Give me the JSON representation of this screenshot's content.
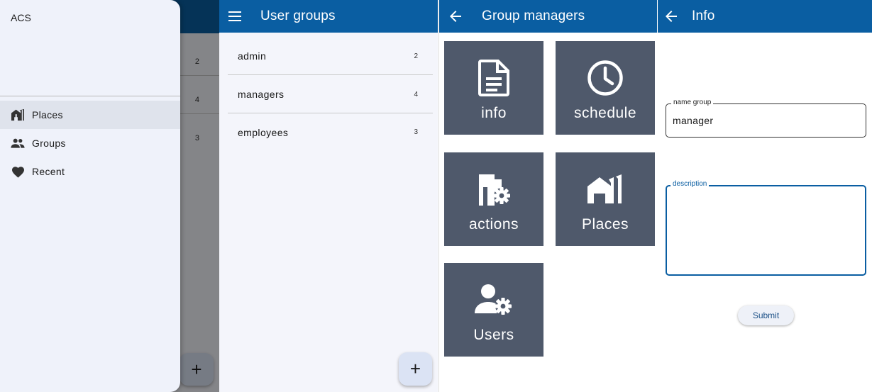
{
  "screen1": {
    "drawer_title": "ACS",
    "items": [
      {
        "label": "Places",
        "icon": "places-icon",
        "active": true
      },
      {
        "label": "Groups",
        "icon": "groups-icon",
        "active": false
      },
      {
        "label": "Recent",
        "icon": "heart-icon",
        "active": false
      }
    ],
    "background_counts": [
      "2",
      "4",
      "3"
    ],
    "fab_label": "+"
  },
  "screen2": {
    "title": "User groups",
    "groups": [
      {
        "name": "admin",
        "count": "2"
      },
      {
        "name": "managers",
        "count": "4"
      },
      {
        "name": "employees",
        "count": "3"
      }
    ],
    "fab_label": "+"
  },
  "screen3": {
    "title": "Group managers",
    "tiles": [
      {
        "label": "info",
        "icon": "document-icon"
      },
      {
        "label": "schedule",
        "icon": "clock-icon"
      },
      {
        "label": "actions",
        "icon": "building-gear-icon"
      },
      {
        "label": "Places",
        "icon": "places-icon"
      },
      {
        "label": "Users",
        "icon": "user-gear-icon"
      }
    ],
    "tile_color": "#4f596b"
  },
  "screen4": {
    "title": "Info",
    "name_label": "name group",
    "name_value": "manager",
    "description_label": "description",
    "description_value": "",
    "submit_label": "Submit"
  },
  "colors": {
    "appbar": "#0a5ea2",
    "drawer_bg": "#eff2fa",
    "fab_bg": "#dbe3f4"
  }
}
